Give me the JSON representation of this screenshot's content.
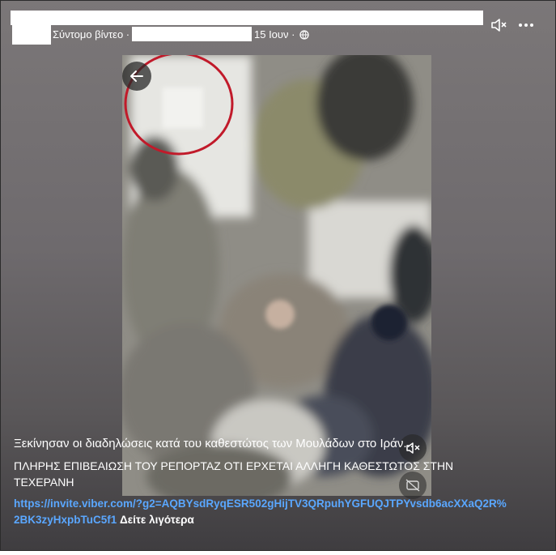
{
  "post": {
    "short_video_label": "Σύντομο βίντεο ·",
    "separator": "·",
    "date": "15 Ιουν ·",
    "title": "Ξεκίνησαν οι διαδηλώσεις κατά του καθεστώτος των Μουλάδων στο Ιράν...",
    "description": "ΠΛΗΡΗΣ ΕΠΙΒΕΑΙΩΣΗ ΤΟΥ ΡΕΠΟΡΤΑΖ ΟΤΙ ΕΡΧΕΤΑΙ ΑΛΛΗΓΗ ΚΑΘΕΣΤΩΤΟΣ ΣΤΗΝ ΤΕΧΕΡΑΝΗ",
    "link": "https://invite.viber.com/?g2=AQBYsdRyqESR502gHijTV3QRpuhYGFUQJTPYvsdb6acXXaQ2R%2BK3zyHxpbTuC5f1",
    "see_more": "Δείτε λιγότερα"
  },
  "icons": {
    "globe": "globe-icon",
    "mute": "speaker-muted-icon",
    "more": "more-options-icon",
    "back": "arrow-left-icon",
    "volume": "speaker-muted-icon",
    "captions": "captions-off-icon"
  }
}
